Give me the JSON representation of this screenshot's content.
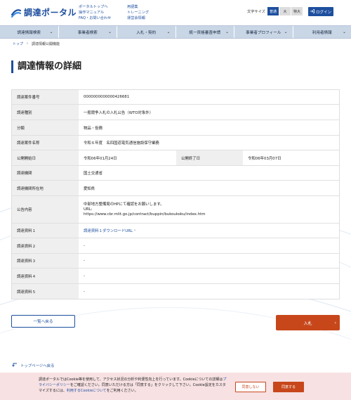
{
  "header": {
    "logo_text": "調達ポータル",
    "links_col1": [
      "ポータルトップへ",
      "操作マニュアル",
      "FAQ・お問い合わせ"
    ],
    "links_col2": [
      "用語集",
      "トレーニング",
      "運営会情報"
    ],
    "text_size_label": "文字サイズ",
    "size_options": [
      "普通",
      "大",
      "特大"
    ],
    "login_label": "ログイン",
    "brand_color": "#1d4f9e"
  },
  "nav": {
    "items": [
      "調達情報検索",
      "事業者検索",
      "入札・契約",
      "統一資格審査申請",
      "事業者プロフィール",
      "利用者情報"
    ]
  },
  "breadcrumb": {
    "items": [
      "トップ",
      "調達情報公開機能"
    ],
    "separator": "›"
  },
  "page_title": "調達情報の詳細",
  "detail": {
    "case_no_label": "調達案件番号",
    "case_no": "0000000000000426681",
    "type_label": "調達種別",
    "type": "一般競争入札の入札公告（WTO対象外）",
    "category_label": "分類",
    "category": "物品・役務",
    "name_label": "調達案件名称",
    "name": "令和６年度　名四国道電気通信施設保守業務",
    "start_label": "公開開始日",
    "start": "令和06年01月24日",
    "end_label": "公開終了日",
    "end": "令和06年03月07日",
    "org_label": "調達機関",
    "org": "国土交通省",
    "location_label": "調達機関所在地",
    "location": "愛知県",
    "content_label": "公告内容",
    "content_line1": "中部地方整備局のHPにて確認をお願いします。",
    "content_line2": "URL:",
    "content_line3": "https://www.cbr.mlit.go.jp/contract/buppin/bukoukoku/index.htm",
    "doc1_label": "調達資料１",
    "doc1": "調達資料１ダウンロードURL",
    "doc2_label": "調達資料２",
    "doc2": "-",
    "doc3_label": "調達資料３",
    "doc3": "-",
    "doc4_label": "調達資料４",
    "doc4": "-",
    "doc5_label": "調達資料５",
    "doc5": "-"
  },
  "buttons": {
    "back": "一覧へ戻る",
    "bid": "入札"
  },
  "pagetop": "トップページへ戻る",
  "cookie": {
    "text_part1": "調達ポータルではCookie等を使用して、アクセス状況の分析や利便性向上を行っています。Cookieについての詳細は",
    "privacy_link": "プライバシーポリシー",
    "text_part2": "をご確認ください。同意いただける方は「同意する」をクリックして下さい。Cookie設定をカスタマイズするには、",
    "settings_link": "利用するCookieについて",
    "text_part3": "をご利用ください。",
    "reject": "同意しない",
    "accept": "同意する",
    "accent_color": "#c7471b"
  }
}
